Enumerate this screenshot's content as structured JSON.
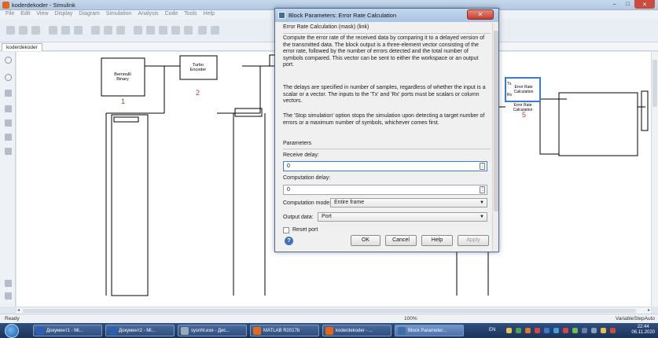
{
  "window": {
    "title": "koderdekoder - Simulink",
    "min": "–",
    "max": "□",
    "close": "✕"
  },
  "menu": [
    "File",
    "Edit",
    "View",
    "Display",
    "Diagram",
    "Simulation",
    "Analysis",
    "Code",
    "Tools",
    "Help"
  ],
  "tab": {
    "label": "koderdekoder"
  },
  "model": {
    "blocks": [
      {
        "id": "bernoulli",
        "label1": "Bernoulli",
        "label2": "Binary",
        "number": "1"
      },
      {
        "id": "turbo",
        "label1": "Turbo",
        "label2": "Encoder",
        "number": "2"
      },
      {
        "id": "error_rate",
        "port_tx": "Tx",
        "port_rx": "Rx",
        "label1": "Error Rate",
        "label2": "Calculation",
        "caption1": "Error Rate",
        "caption2": "Calculation",
        "number": "5"
      }
    ]
  },
  "status": {
    "left": "Ready",
    "zoom": "100%",
    "right": "VariableStepAuto"
  },
  "taskbar": {
    "tasks": [
      "Документ1 - Mi...",
      "Документ2 - Mi...",
      "sysnht.exe - Дис...",
      "MATLAB R2017b",
      "koderdekoder - ...",
      "Block Parameter..."
    ],
    "lang": "EN",
    "time": "22:44",
    "date": "06.11.2020"
  },
  "dialog": {
    "title": "Block Parameters: Error Rate Calculation",
    "close": "✕",
    "header": "Error Rate Calculation (mask) (link)",
    "desc1": "Compute the error rate of the received data by comparing it to a delayed version of the transmitted data. The block output is a three-element vector consisting of the error rate, followed by the number of errors detected and the total number of symbols compared. This vector can be sent to either the workspace or an output port.",
    "desc2": "The delays are specified in number of samples, regardless of whether the input is a scalar or a vector. The inputs to the 'Tx' and 'Rx' ports must be scalars or column vectors.",
    "desc3": "The 'Stop simulation' option stops the simulation upon detecting a target number of errors or a maximum number of symbols, whichever comes first.",
    "params_label": "Parameters",
    "receive_delay_label": "Receive delay:",
    "receive_delay_value": "0",
    "computation_delay_label": "Computation delay:",
    "computation_delay_value": "0",
    "computation_mode_label": "Computation mode:",
    "computation_mode_value": "Entire frame",
    "output_data_label": "Output data:",
    "output_data_value": "Port",
    "reset_port_label": "Reset port",
    "ok": "OK",
    "cancel": "Cancel",
    "help": "Help",
    "apply": "Apply"
  }
}
